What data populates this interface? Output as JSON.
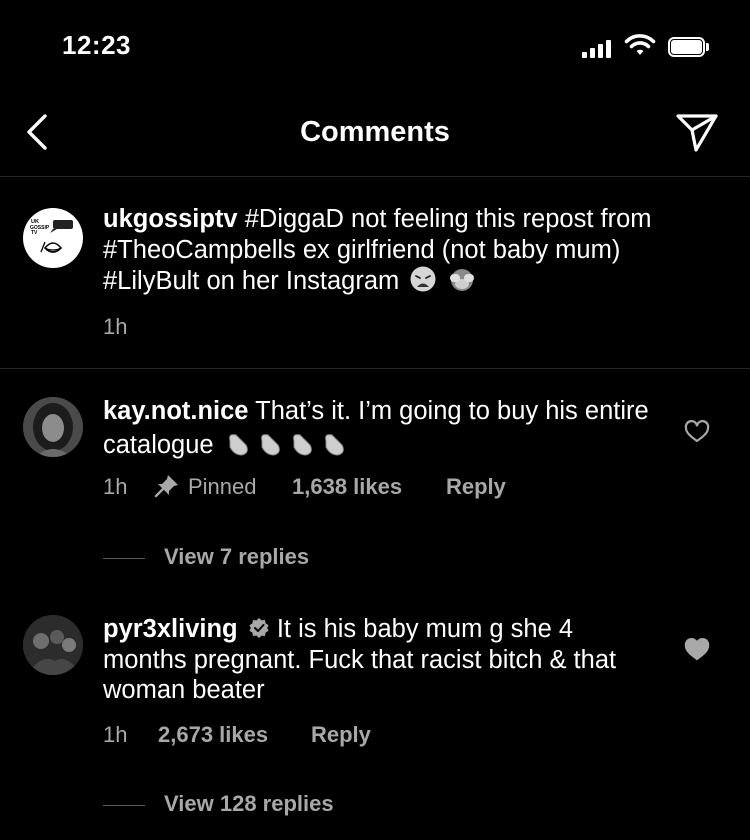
{
  "status_bar": {
    "time": "12:23"
  },
  "header": {
    "title": "Comments"
  },
  "caption": {
    "username": "ukgossiptv",
    "text": "#DiggaD not feeling this repost from #TheoCampbells ex girlfriend (not baby mum) #LilyBult on her Instagram",
    "time": "1h",
    "avatar_text": "UK GOSSIP TV"
  },
  "comments": [
    {
      "username": "kay.not.nice",
      "text": "That’s it. I’m going to buy his entire catalogue",
      "time": "1h",
      "pinned_label": "Pinned",
      "likes": "1,638 likes",
      "reply_label": "Reply",
      "view_replies": "View 7 replies"
    },
    {
      "username": "pyr3xliving",
      "text": "It is his baby mum g she 4 months pregnant. Fuck that racist bitch & that woman beater",
      "time": "1h",
      "likes": "2,673 likes",
      "reply_label": "Reply",
      "view_replies": "View 128 replies"
    }
  ],
  "icons": {
    "back": "chevron-left-icon",
    "send": "paper-plane-icon",
    "pin": "pin-icon",
    "like": "heart-icon",
    "verified": "verified-badge-icon"
  }
}
